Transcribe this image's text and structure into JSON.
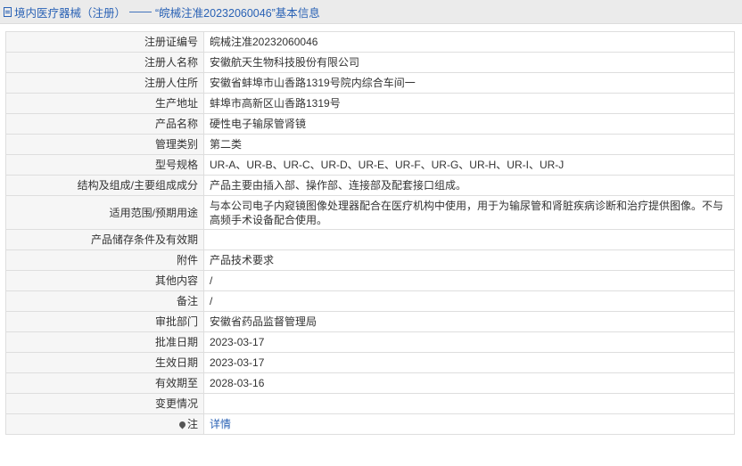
{
  "header": {
    "category": "境内医疗器械（注册）",
    "separator": "——",
    "record_title": "“皖械注准20232060046”基本信息"
  },
  "rows": [
    {
      "label": "注册证编号",
      "value": "皖械注准20232060046"
    },
    {
      "label": "注册人名称",
      "value": "安徽航天生物科技股份有限公司"
    },
    {
      "label": "注册人住所",
      "value": "安徽省蚌埠市山香路1319号院内综合车间一"
    },
    {
      "label": "生产地址",
      "value": "蚌埠市高新区山香路1319号"
    },
    {
      "label": "产品名称",
      "value": "硬性电子输尿管肾镜"
    },
    {
      "label": "管理类别",
      "value": "第二类"
    },
    {
      "label": "型号规格",
      "value": "UR-A、UR-B、UR-C、UR-D、UR-E、UR-F、UR-G、UR-H、UR-I、UR-J"
    },
    {
      "label": "结构及组成/主要组成成分",
      "value": "产品主要由插入部、操作部、连接部及配套接口组成。"
    },
    {
      "label": "适用范围/预期用途",
      "value": "与本公司电子内窥镜图像处理器配合在医疗机构中使用，用于为输尿管和肾脏疾病诊断和治疗提供图像。不与高频手术设备配合使用。"
    },
    {
      "label": "产品储存条件及有效期",
      "value": ""
    },
    {
      "label": "附件",
      "value": "产品技术要求"
    },
    {
      "label": "其他内容",
      "value": "/"
    },
    {
      "label": "备注",
      "value": "/"
    },
    {
      "label": "审批部门",
      "value": "安徽省药品监督管理局"
    },
    {
      "label": "批准日期",
      "value": "2023-03-17"
    },
    {
      "label": "生效日期",
      "value": "2023-03-17"
    },
    {
      "label": "有效期至",
      "value": "2028-03-16"
    },
    {
      "label": "变更情况",
      "value": ""
    },
    {
      "label": "注",
      "value": "详情"
    }
  ]
}
